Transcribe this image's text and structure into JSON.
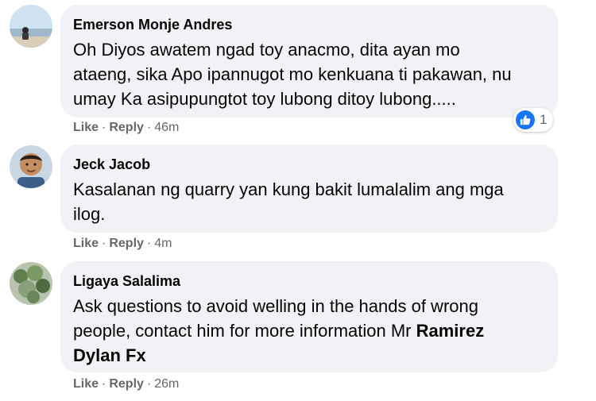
{
  "comments": [
    {
      "author": "Emerson Monje Andres",
      "lines": [
        "Oh Diyos awatem ngad toy anacmo, dita ayan mo",
        "ataeng, sika Apo ipannugot mo kenkuana ti pakawan, nu",
        "umay Ka asipupungtot toy lubong ditoy lubong....."
      ],
      "like": "Like",
      "reply": "Reply",
      "sep": "·",
      "time": "46m",
      "reactions": {
        "icon": "like-icon",
        "count": "1"
      }
    },
    {
      "author": "Jeck Jacob",
      "lines": [
        "Kasalanan ng quarry yan kung bakit lumalalim ang mga",
        "ilog."
      ],
      "like": "Like",
      "reply": "Reply",
      "sep": "·",
      "time": "4m"
    },
    {
      "author": "Ligaya Salalima",
      "lines": [
        "Ask questions to avoid welling in the hands of wrong",
        "people, contact him for more information Mr "
      ],
      "mention_part1": "Ramirez",
      "mention_part2": "Dylan Fx",
      "like": "Like",
      "reply": "Reply",
      "sep": "·",
      "time": "26m"
    }
  ],
  "colors": {
    "bubble": "#f0f2f5",
    "meta_text": "#65676b",
    "like_blue": "#1877f2"
  }
}
